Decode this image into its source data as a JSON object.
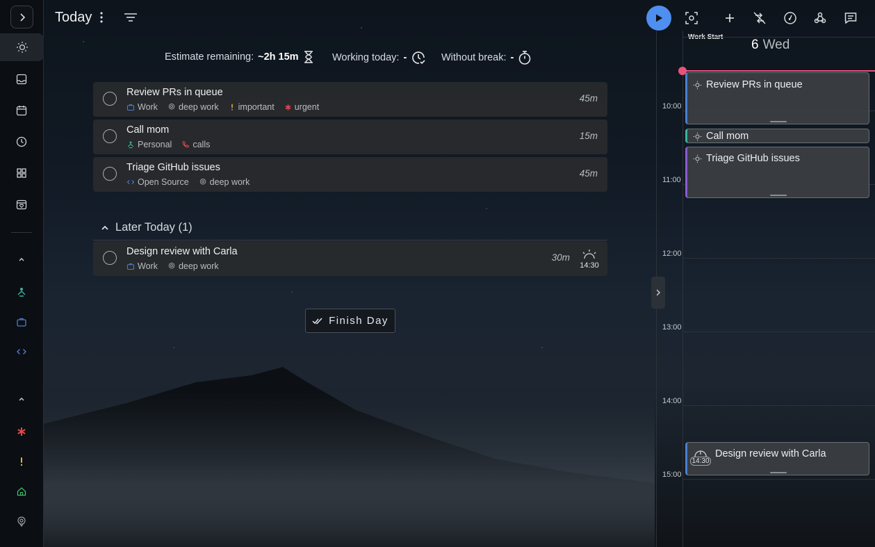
{
  "header": {
    "title": "Today",
    "estimate_label": "Estimate remaining:",
    "estimate_value": "~2h 15m",
    "working_label": "Working today:",
    "working_value": "-",
    "break_label": "Without break:",
    "break_value": "-"
  },
  "tasks": [
    {
      "title": "Review PRs in queue",
      "duration": "45m",
      "tags": [
        {
          "label": "Work",
          "icon": "briefcase-icon",
          "color": "#4a7fd0"
        },
        {
          "label": "deep work",
          "icon": "target-icon",
          "color": "#9aa0a6"
        },
        {
          "label": "important",
          "icon": "exclamation-icon",
          "color": "#e8b030"
        },
        {
          "label": "urgent",
          "icon": "asterisk-icon",
          "color": "#e5484d"
        }
      ]
    },
    {
      "title": "Call mom",
      "duration": "15m",
      "tags": [
        {
          "label": "Personal",
          "icon": "person-icon",
          "color": "#3bb3a0"
        },
        {
          "label": "calls",
          "icon": "phone-icon",
          "color": "#e5484d"
        }
      ]
    },
    {
      "title": "Triage GitHub issues",
      "duration": "45m",
      "tags": [
        {
          "label": "Open Source",
          "icon": "code-icon",
          "color": "#4a7fd0"
        },
        {
          "label": "deep work",
          "icon": "target-icon",
          "color": "#9aa0a6"
        }
      ]
    }
  ],
  "later": {
    "label": "Later Today (1)",
    "tasks": [
      {
        "title": "Design review with Carla",
        "duration": "30m",
        "start_time": "14:30",
        "tags": [
          {
            "label": "Work",
            "icon": "briefcase-icon",
            "color": "#4a7fd0"
          },
          {
            "label": "deep work",
            "icon": "target-icon",
            "color": "#9aa0a6"
          }
        ]
      }
    ]
  },
  "finish_button": "Finish Day",
  "calendar": {
    "work_start": "Work Start",
    "day_number": "6",
    "day_name": "Wed",
    "hours": [
      "10:00",
      "11:00",
      "12:00",
      "13:00",
      "14:00",
      "15:00"
    ],
    "events": [
      {
        "title": "Review PRs in queue",
        "accent": "#4a7fd0"
      },
      {
        "title": "Call mom",
        "accent": "#3bb3a0"
      },
      {
        "title": "Triage GitHub issues",
        "accent": "#8a5cd0"
      },
      {
        "title": "Design review with Carla",
        "accent": "#4a7fd0",
        "time": "14:30"
      }
    ]
  },
  "colors": {
    "accent": "#4f8ff0",
    "now_line": "#e9537a"
  }
}
